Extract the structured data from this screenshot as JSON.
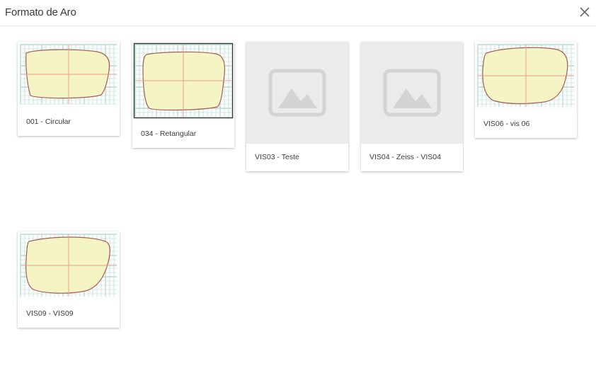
{
  "dialog": {
    "title": "Formato de Aro",
    "close_icon": "close-icon"
  },
  "colors": {
    "grid_minor": "#b9d8cf",
    "grid_major": "#9fc7bb",
    "axis": "#e39a8c",
    "lens_fill": "#f4f4c4",
    "lens_stroke": "#a25f57",
    "placeholder_bg": "#ebebeb",
    "placeholder_icon": "#d4d4d4"
  },
  "frames": [
    {
      "label": "001 - Circular",
      "image": "lens-shape-preview"
    },
    {
      "label": "034 - Retangular",
      "image": "lens-shape-preview"
    },
    {
      "label": "VIS03 - Teste",
      "image": "image-placeholder-icon"
    },
    {
      "label": "VIS04 - Zeiss - VIS04",
      "image": "image-placeholder-icon"
    },
    {
      "label": "VIS06 - vis 06",
      "image": "lens-shape-preview"
    },
    {
      "label": "VIS09 - VIS09",
      "image": "lens-shape-preview"
    }
  ]
}
